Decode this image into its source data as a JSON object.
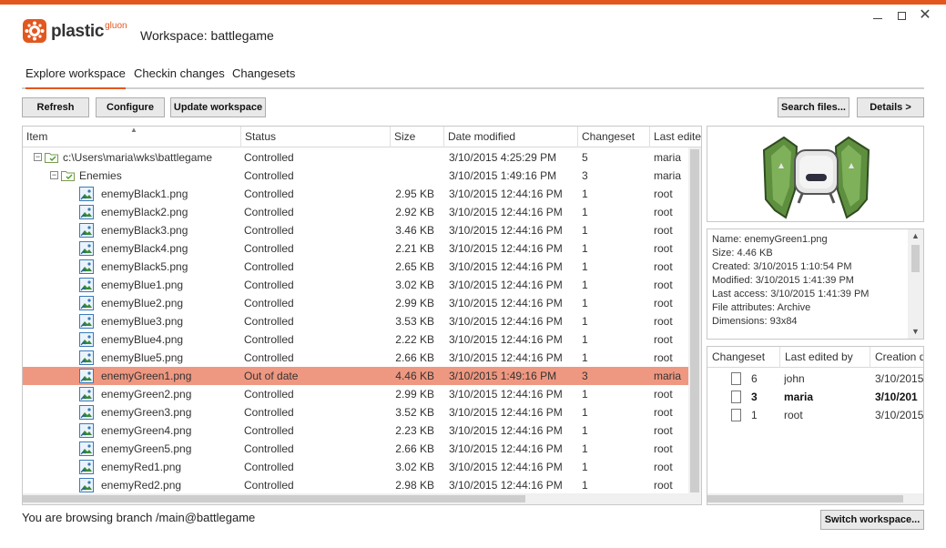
{
  "app": {
    "logo_text": "plastic",
    "logo_sup": "gluon",
    "workspace_title": "Workspace: battlegame"
  },
  "tabs": [
    {
      "label": "Explore workspace",
      "active": true
    },
    {
      "label": "Checkin changes",
      "active": false
    },
    {
      "label": "Changesets",
      "active": false
    }
  ],
  "toolbar": {
    "refresh": "Refresh",
    "configure": "Configure",
    "update": "Update workspace",
    "search": "Search files...",
    "details": "Details >"
  },
  "file_table": {
    "columns": [
      "Item",
      "Status",
      "Size",
      "Date modified",
      "Changeset",
      "Last edite"
    ],
    "rows": [
      {
        "type": "folder",
        "level": 0,
        "name": "c:\\Users\\maria\\wks\\battlegame",
        "status": "Controlled",
        "size": "",
        "date": "3/10/2015 4:25:29 PM",
        "changeset": "5",
        "by": "maria"
      },
      {
        "type": "folder",
        "level": 1,
        "name": "Enemies",
        "status": "Controlled",
        "size": "",
        "date": "3/10/2015 1:49:16 PM",
        "changeset": "3",
        "by": "maria"
      },
      {
        "type": "file",
        "name": "enemyBlack1.png",
        "status": "Controlled",
        "size": "2.95 KB",
        "date": "3/10/2015 12:44:16 PM",
        "changeset": "1",
        "by": "root"
      },
      {
        "type": "file",
        "name": "enemyBlack2.png",
        "status": "Controlled",
        "size": "2.92 KB",
        "date": "3/10/2015 12:44:16 PM",
        "changeset": "1",
        "by": "root"
      },
      {
        "type": "file",
        "name": "enemyBlack3.png",
        "status": "Controlled",
        "size": "3.46 KB",
        "date": "3/10/2015 12:44:16 PM",
        "changeset": "1",
        "by": "root"
      },
      {
        "type": "file",
        "name": "enemyBlack4.png",
        "status": "Controlled",
        "size": "2.21 KB",
        "date": "3/10/2015 12:44:16 PM",
        "changeset": "1",
        "by": "root"
      },
      {
        "type": "file",
        "name": "enemyBlack5.png",
        "status": "Controlled",
        "size": "2.65 KB",
        "date": "3/10/2015 12:44:16 PM",
        "changeset": "1",
        "by": "root"
      },
      {
        "type": "file",
        "name": "enemyBlue1.png",
        "status": "Controlled",
        "size": "3.02 KB",
        "date": "3/10/2015 12:44:16 PM",
        "changeset": "1",
        "by": "root"
      },
      {
        "type": "file",
        "name": "enemyBlue2.png",
        "status": "Controlled",
        "size": "2.99 KB",
        "date": "3/10/2015 12:44:16 PM",
        "changeset": "1",
        "by": "root"
      },
      {
        "type": "file",
        "name": "enemyBlue3.png",
        "status": "Controlled",
        "size": "3.53 KB",
        "date": "3/10/2015 12:44:16 PM",
        "changeset": "1",
        "by": "root"
      },
      {
        "type": "file",
        "name": "enemyBlue4.png",
        "status": "Controlled",
        "size": "2.22 KB",
        "date": "3/10/2015 12:44:16 PM",
        "changeset": "1",
        "by": "root"
      },
      {
        "type": "file",
        "name": "enemyBlue5.png",
        "status": "Controlled",
        "size": "2.66 KB",
        "date": "3/10/2015 12:44:16 PM",
        "changeset": "1",
        "by": "root"
      },
      {
        "type": "file",
        "name": "enemyGreen1.png",
        "status": "Out of date",
        "size": "4.46 KB",
        "date": "3/10/2015 1:49:16 PM",
        "changeset": "3",
        "by": "maria",
        "selected": true
      },
      {
        "type": "file",
        "name": "enemyGreen2.png",
        "status": "Controlled",
        "size": "2.99 KB",
        "date": "3/10/2015 12:44:16 PM",
        "changeset": "1",
        "by": "root"
      },
      {
        "type": "file",
        "name": "enemyGreen3.png",
        "status": "Controlled",
        "size": "3.52 KB",
        "date": "3/10/2015 12:44:16 PM",
        "changeset": "1",
        "by": "root"
      },
      {
        "type": "file",
        "name": "enemyGreen4.png",
        "status": "Controlled",
        "size": "2.23 KB",
        "date": "3/10/2015 12:44:16 PM",
        "changeset": "1",
        "by": "root"
      },
      {
        "type": "file",
        "name": "enemyGreen5.png",
        "status": "Controlled",
        "size": "2.66 KB",
        "date": "3/10/2015 12:44:16 PM",
        "changeset": "1",
        "by": "root"
      },
      {
        "type": "file",
        "name": "enemyRed1.png",
        "status": "Controlled",
        "size": "3.02 KB",
        "date": "3/10/2015 12:44:16 PM",
        "changeset": "1",
        "by": "root"
      },
      {
        "type": "file",
        "name": "enemyRed2.png",
        "status": "Controlled",
        "size": "2.98 KB",
        "date": "3/10/2015 12:44:16 PM",
        "changeset": "1",
        "by": "root"
      }
    ]
  },
  "details": {
    "lines": [
      "Name: enemyGreen1.png",
      "Size: 4.46 KB",
      "Created: 3/10/2015 1:10:54 PM",
      "Modified: 3/10/2015 1:41:39 PM",
      "Last access: 3/10/2015 1:41:39 PM",
      "File attributes: Archive",
      "Dimensions: 93x84"
    ]
  },
  "history": {
    "columns": [
      "Changeset",
      "Last edited by",
      "Creation d"
    ],
    "rows": [
      {
        "changeset": "6",
        "by": "john",
        "date": "3/10/2015",
        "bold": false
      },
      {
        "changeset": "3",
        "by": "maria",
        "date": "3/10/201",
        "bold": true
      },
      {
        "changeset": "1",
        "by": "root",
        "date": "3/10/2015",
        "bold": false
      }
    ]
  },
  "status": {
    "branch_text": "You are browsing branch /main@battlegame",
    "switch_button": "Switch workspace..."
  },
  "colors": {
    "accent": "#e2571e",
    "selected_row": "#ef9881",
    "preview_green": "#5a8a3c"
  }
}
